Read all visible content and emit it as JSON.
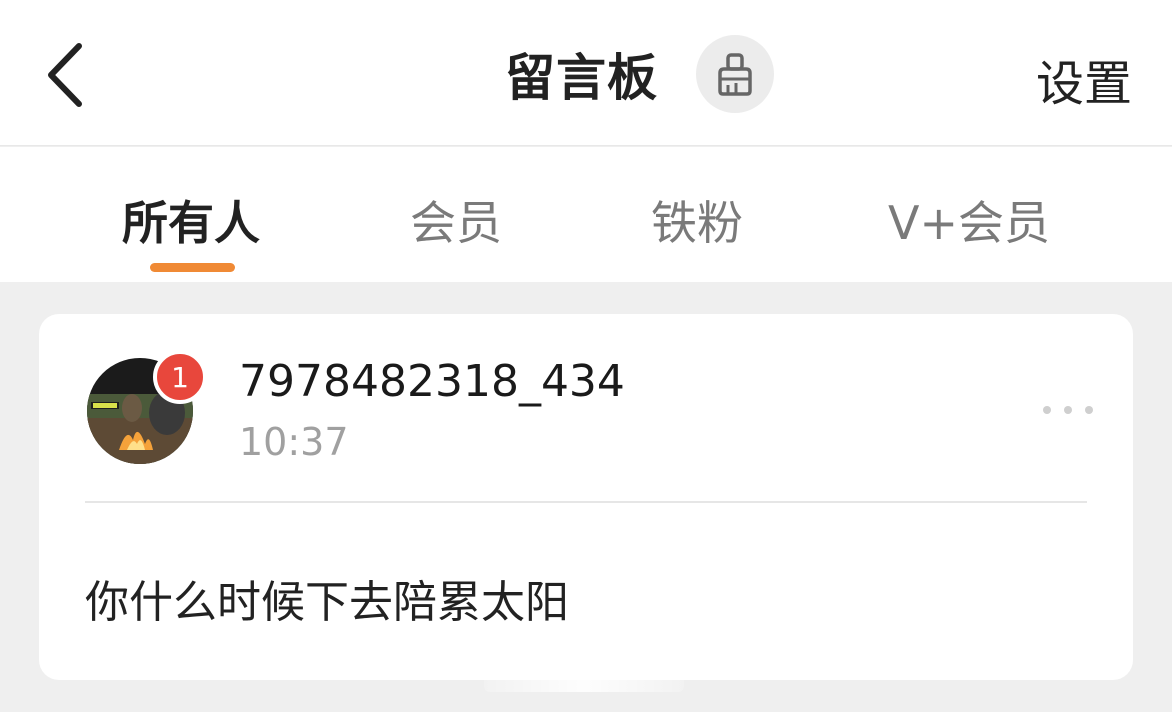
{
  "header": {
    "title": "留言板",
    "settings_label": "设置"
  },
  "tabs": [
    {
      "label": "所有人",
      "active": true
    },
    {
      "label": "会员",
      "active": false
    },
    {
      "label": "铁粉",
      "active": false
    },
    {
      "label": "V+会员",
      "active": false
    }
  ],
  "colors": {
    "accent": "#f08a35",
    "badge": "#e8473c"
  },
  "message_card": {
    "badge_count": "1",
    "username": "7978482318_434",
    "time": "10:37",
    "content": "你什么时候下去陪累太阳",
    "avatar_icon": "campfire-avatar"
  }
}
